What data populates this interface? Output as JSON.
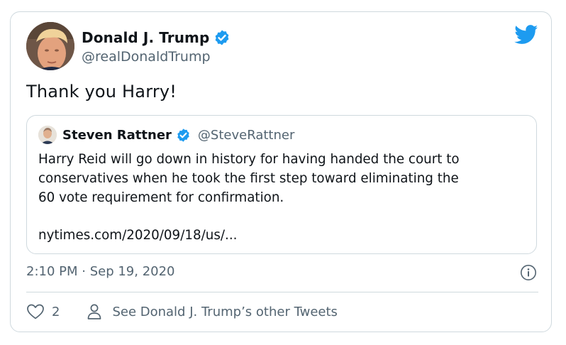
{
  "author": {
    "display_name": "Donald J. Trump",
    "handle": "@realDonaldTrump",
    "verified_icon": "verified-badge-icon"
  },
  "tweet": {
    "text": "Thank you Harry!",
    "timestamp": "2:10 PM · Sep 19, 2020",
    "likes": "2",
    "other_tweets_label": "See Donald J. Trump’s other Tweets"
  },
  "quoted": {
    "display_name": "Steven Rattner",
    "handle": "@SteveRattner",
    "body_lines": [
      "Harry Reid will go down in history for having handed the court to",
      "conservatives when he took the first step toward eliminating the",
      "60 vote requirement for confirmation."
    ],
    "link": "nytimes.com/2020/09/18/us/..."
  },
  "icons": {
    "brand": "twitter-bird-icon",
    "info": "info-icon",
    "like": "heart-icon",
    "profile": "person-icon"
  },
  "colors": {
    "brand_blue": "#1d9bf0",
    "secondary_text": "#536471",
    "border": "#cfd9de"
  }
}
